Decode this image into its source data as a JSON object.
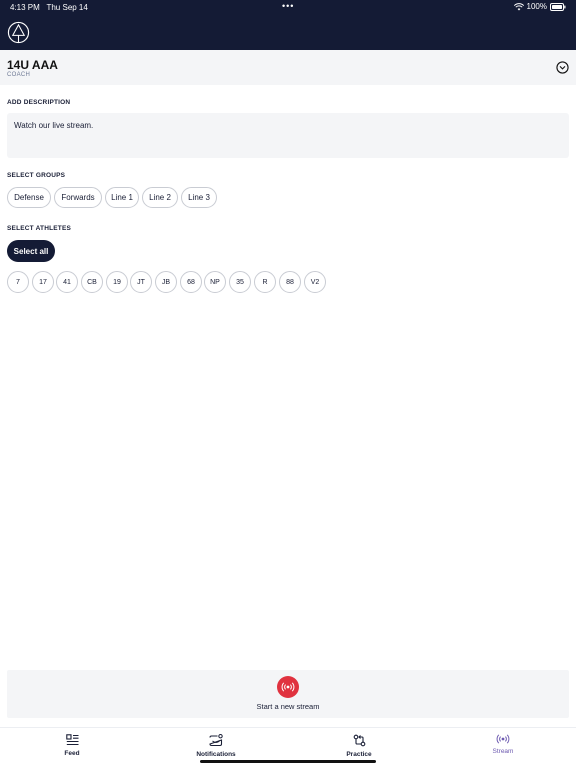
{
  "status_bar": {
    "time": "4:13 PM",
    "date": "Thu Sep 14",
    "battery": "100%"
  },
  "team": {
    "name": "14U AAA",
    "role": "COACH"
  },
  "description": {
    "label": "ADD DESCRIPTION",
    "value": "Watch our live stream."
  },
  "groups": {
    "label": "SELECT GROUPS",
    "items": [
      "Defense",
      "Forwards",
      "Line 1",
      "Line 2",
      "Line 3"
    ]
  },
  "athletes": {
    "label": "SELECT ATHLETES",
    "select_all": "Select all",
    "items": [
      "7",
      "17",
      "41",
      "CB",
      "19",
      "JT",
      "JB",
      "68",
      "NP",
      "35",
      "R",
      "88",
      "V2"
    ]
  },
  "stream": {
    "label": "Start a new stream"
  },
  "tabs": [
    {
      "label": "Feed",
      "icon": "feed-icon"
    },
    {
      "label": "Notifications",
      "icon": "notifications-icon"
    },
    {
      "label": "Practice",
      "icon": "practice-icon"
    },
    {
      "label": "Stream",
      "icon": "stream-icon",
      "active": true
    }
  ],
  "colors": {
    "navy": "#141b35",
    "accent_red": "#e0323f",
    "active_tab": "#6e5bb1",
    "panel_bg": "#f4f5f7"
  }
}
